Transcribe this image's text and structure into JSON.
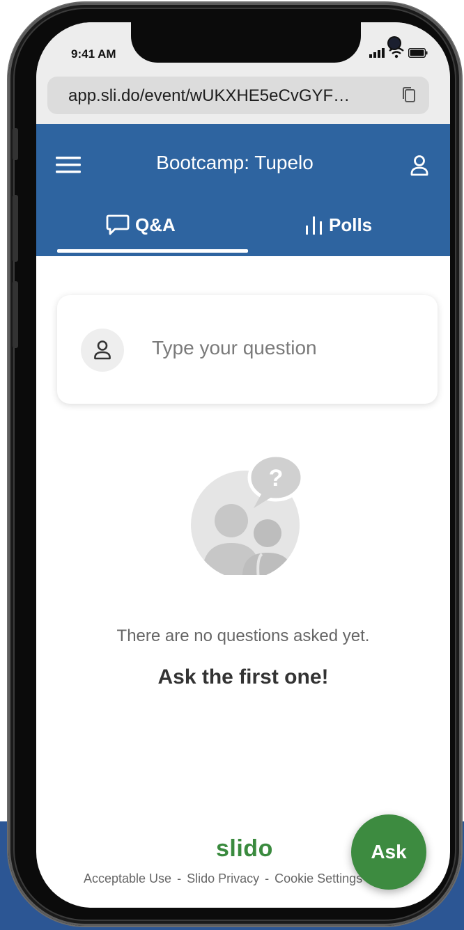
{
  "status_bar": {
    "time": "9:41 AM"
  },
  "browser": {
    "url": "app.sli.do/event/wUKXHE5eCvGYF…"
  },
  "header": {
    "event_title": "Bootcamp: Tupelo",
    "tabs": [
      {
        "label": "Q&A",
        "icon": "chat-bubble-icon",
        "active": true
      },
      {
        "label": "Polls",
        "icon": "bar-chart-icon",
        "active": false
      }
    ]
  },
  "question_input": {
    "placeholder": "Type your question"
  },
  "empty_state": {
    "message": "There are no questions asked yet.",
    "cta": "Ask the first one!"
  },
  "footer": {
    "brand": "slido",
    "links": [
      "Acceptable Use",
      "Slido Privacy",
      "Cookie Settings"
    ],
    "separator": "-"
  },
  "fab": {
    "label": "Ask"
  },
  "colors": {
    "header": "#2e64a0",
    "accent_green": "#3d8b40",
    "brand_green": "#3a8a3e",
    "page_band": "#2c5694"
  }
}
